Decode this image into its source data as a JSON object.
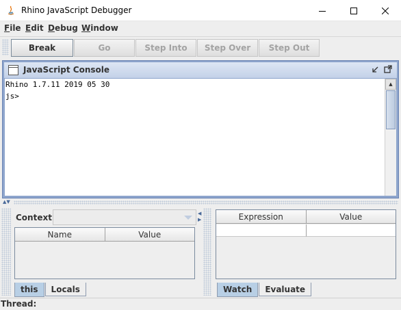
{
  "window": {
    "title": "Rhino JavaScript Debugger"
  },
  "menubar": {
    "items": [
      {
        "mnemonic": "F",
        "rest": "ile"
      },
      {
        "mnemonic": "E",
        "rest": "dit"
      },
      {
        "mnemonic": "D",
        "rest": "ebug"
      },
      {
        "mnemonic": "W",
        "rest": "indow"
      }
    ]
  },
  "toolbar": {
    "break_label": "Break",
    "go_label": "Go",
    "step_into_label": "Step Into",
    "step_over_label": "Step Over",
    "step_out_label": "Step Out"
  },
  "console": {
    "title": "JavaScript Console",
    "lines": [
      "Rhino 1.7.11 2019 05 30",
      "js>"
    ]
  },
  "context_panel": {
    "context_label": "Context:",
    "context_value": "",
    "columns": [
      "Name",
      "Value"
    ],
    "tabs": [
      "this",
      "Locals"
    ],
    "active_tab": "this"
  },
  "watch_panel": {
    "columns": [
      "Expression",
      "Value"
    ],
    "tabs": [
      "Watch",
      "Evaluate"
    ],
    "active_tab": "Watch"
  },
  "statusbar": {
    "thread_label": "Thread:"
  },
  "colors": {
    "frame_border": "#8ea5cc",
    "active_tab": "#b8cfe5",
    "disabled_text": "#a3a3a3"
  }
}
